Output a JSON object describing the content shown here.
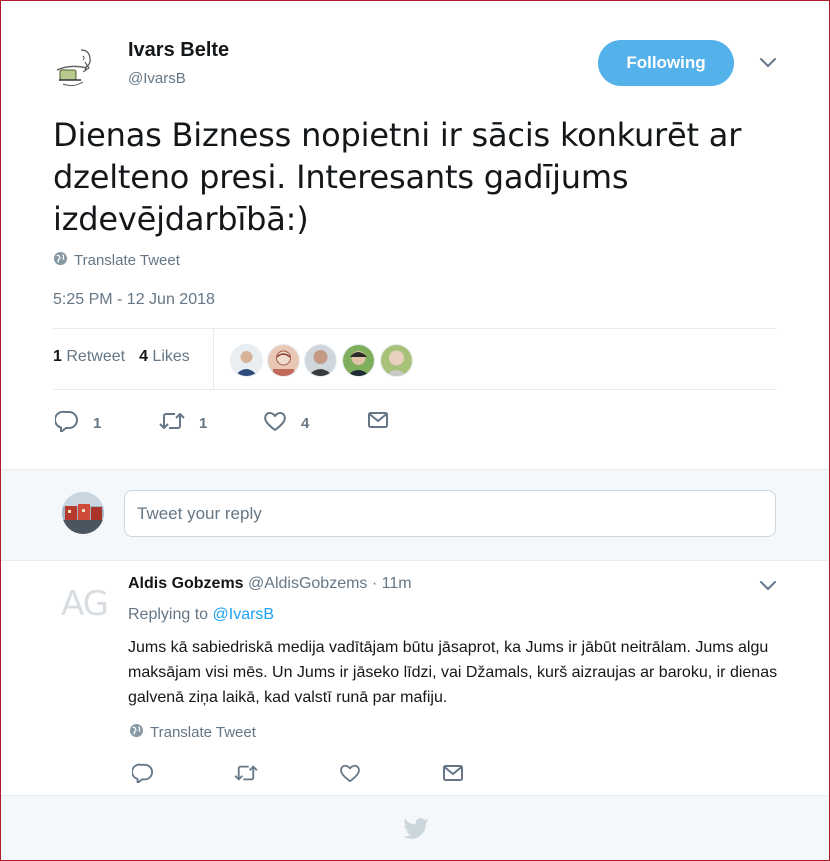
{
  "tweet": {
    "author_name": "Ivars Belte",
    "author_handle": "@IvarsB",
    "follow_label": "Following",
    "text": "Dienas Bizness nopietni ir sācis konkurēt ar dzelteno presi. Interesants gadījums izdevējdarbībā:)",
    "translate_label": "Translate Tweet",
    "timestamp": "5:25 PM - 12 Jun 2018",
    "retweets_count": "1",
    "retweets_label": "Retweet",
    "likes_count": "4",
    "likes_label": "Likes",
    "actions": {
      "reply_count": "1",
      "retweet_count": "1",
      "like_count": "4"
    }
  },
  "reply_box": {
    "placeholder": "Tweet your reply"
  },
  "reply": {
    "avatar_initials": "AG",
    "author_name": "Aldis Gobzems",
    "author_handle": "@AldisGobzems",
    "separator": "·",
    "time": "11m",
    "replying_to_label": "Replying to",
    "replying_to_handle": "@IvarsB",
    "text": "Jums kā sabiedriskā medija vadītājam būtu jāsaprot, ka Jums ir jābūt neitrālam. Jums algu maksājam visi mēs. Un Jums ir jāseko līdzi, vai Džamals, kurš aizraujas ar baroku, ir dienas galvenā ziņa laikā, kad valstī runā par mafiju.",
    "translate_label": "Translate Tweet"
  },
  "colors": {
    "accent": "#1da1f2",
    "follow_button": "#55b1ea",
    "muted_text": "#657786",
    "frame_border": "#b01e2b"
  },
  "icons": [
    "globe-icon",
    "chevron-down-icon",
    "reply-icon",
    "retweet-icon",
    "heart-icon",
    "direct-message-icon",
    "twitter-bird-icon"
  ]
}
